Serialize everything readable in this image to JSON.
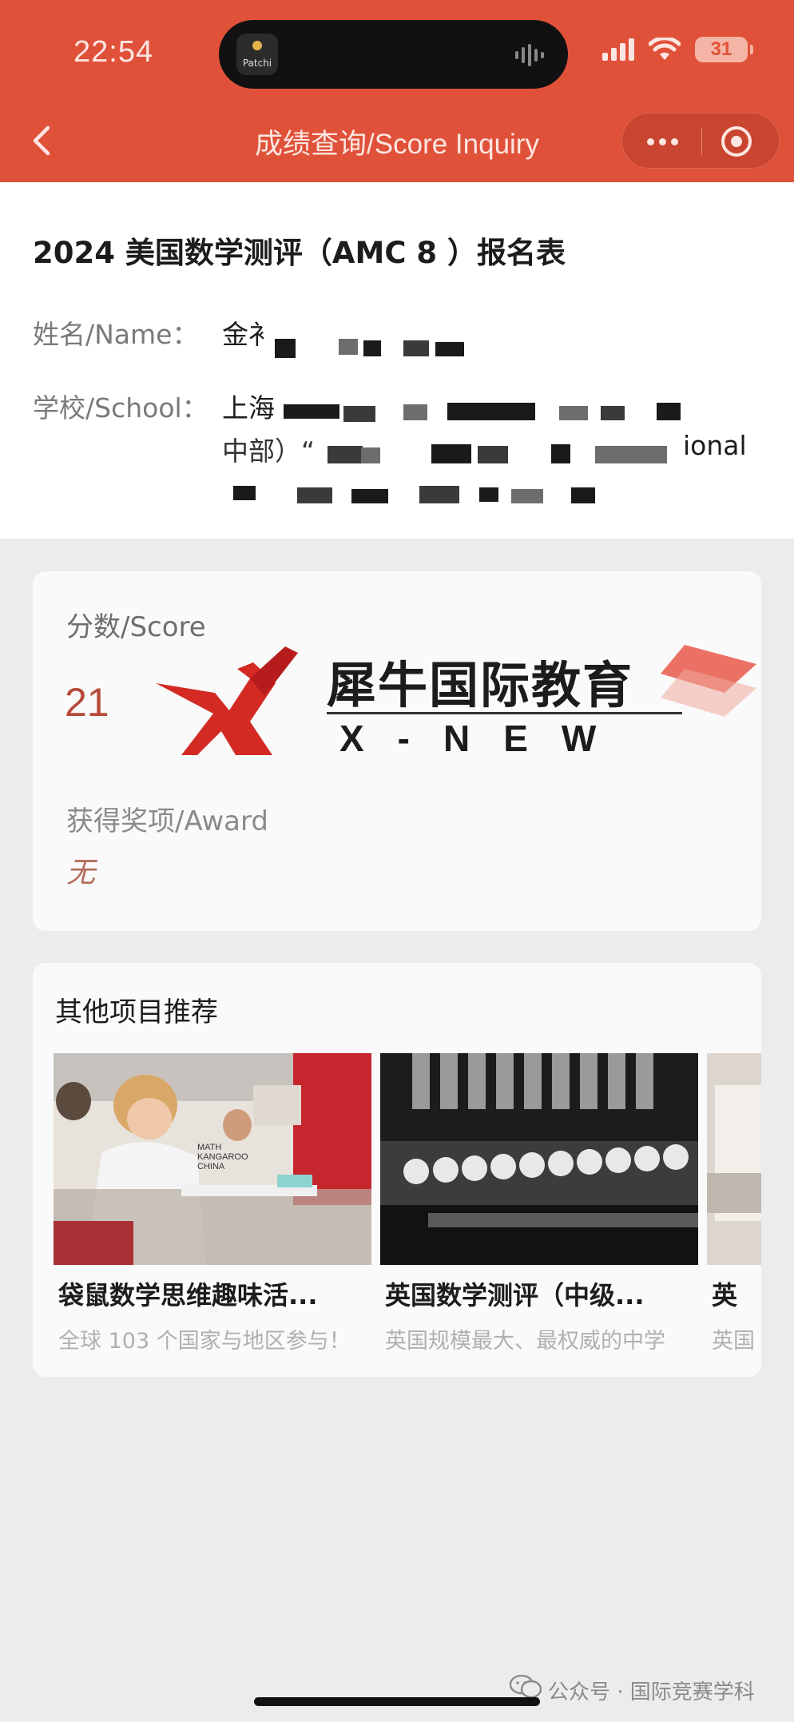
{
  "status_bar": {
    "time": "22:54",
    "island_app": "Patchi",
    "battery": "31"
  },
  "nav": {
    "title": "成绩查询/Score Inquiry"
  },
  "registration": {
    "title": "2024 美国数学测评（AMC 8 ）报名表",
    "name_label": "姓名/Name：",
    "name_value_visible": "金衤",
    "school_label": "学校/School：",
    "school_value_visible": "上海",
    "school_line2_fragment": "中部）“",
    "school_line2_end": "ional"
  },
  "score": {
    "score_label": "分数/Score",
    "score_value": "21",
    "award_label": "获得奖项/Award",
    "award_value": "无"
  },
  "watermark": {
    "name_cn": "犀牛国际教育",
    "name_en": "X-NEW"
  },
  "recommendations": {
    "title": "其他项目推荐",
    "items": [
      {
        "name": "袋鼠数学思维趣味活...",
        "desc": "全球 103 个国家与地区参与！",
        "image_text": "MATH KANGAROO CHINA"
      },
      {
        "name": "英国数学测评（中级...",
        "desc": "英国规模最大、最权威的中学"
      },
      {
        "name": "英",
        "desc": "英国"
      }
    ]
  },
  "footer": {
    "text": "公众号 · 国际竞赛学科"
  },
  "colors": {
    "header_red": "#e0513a",
    "score_red": "#b64a3a",
    "award_brown": "#b46a58"
  }
}
